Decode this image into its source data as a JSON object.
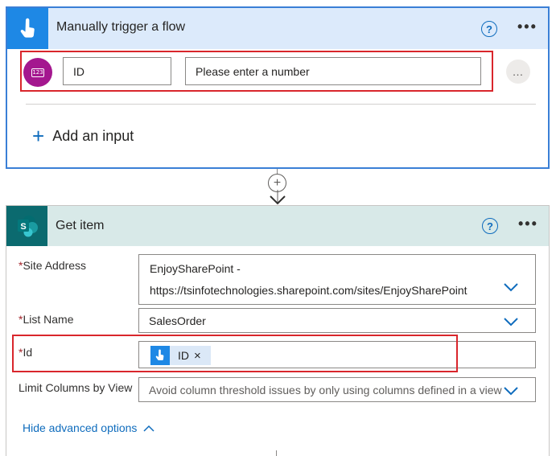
{
  "trigger_card": {
    "title": "Manually trigger a flow",
    "help_glyph": "?",
    "more_glyph": "•••",
    "input_row": {
      "type_icon": "number-input-icon",
      "type_badge": "123",
      "name": "ID",
      "placeholder": "Please enter a number",
      "more_glyph": "…"
    },
    "add_input_label": "Add an input",
    "add_glyph": "+"
  },
  "connector": {
    "plus_glyph": "+"
  },
  "get_item_card": {
    "title": "Get item",
    "help_glyph": "?",
    "more_glyph": "•••",
    "required_mark": "*",
    "site_address": {
      "label": "Site Address",
      "value_line1": "EnjoySharePoint -",
      "value_line2": "https://tsinfotechnologies.sharepoint.com/sites/EnjoySharePoint"
    },
    "list_name": {
      "label": "List Name",
      "value": "SalesOrder"
    },
    "id": {
      "label": "Id",
      "token_label": "ID",
      "token_remove": "×"
    },
    "limit_columns": {
      "label": "Limit Columns by View",
      "value": "Avoid column threshold issues by only using columns defined in a view"
    },
    "advanced_label": "Hide advanced options"
  },
  "colors": {
    "trigger_accent": "#1e88e5",
    "sharepoint_accent": "#0b6a6f",
    "number_icon": "#a4178f",
    "highlight": "#d9262c",
    "link": "#0f6cbd"
  }
}
